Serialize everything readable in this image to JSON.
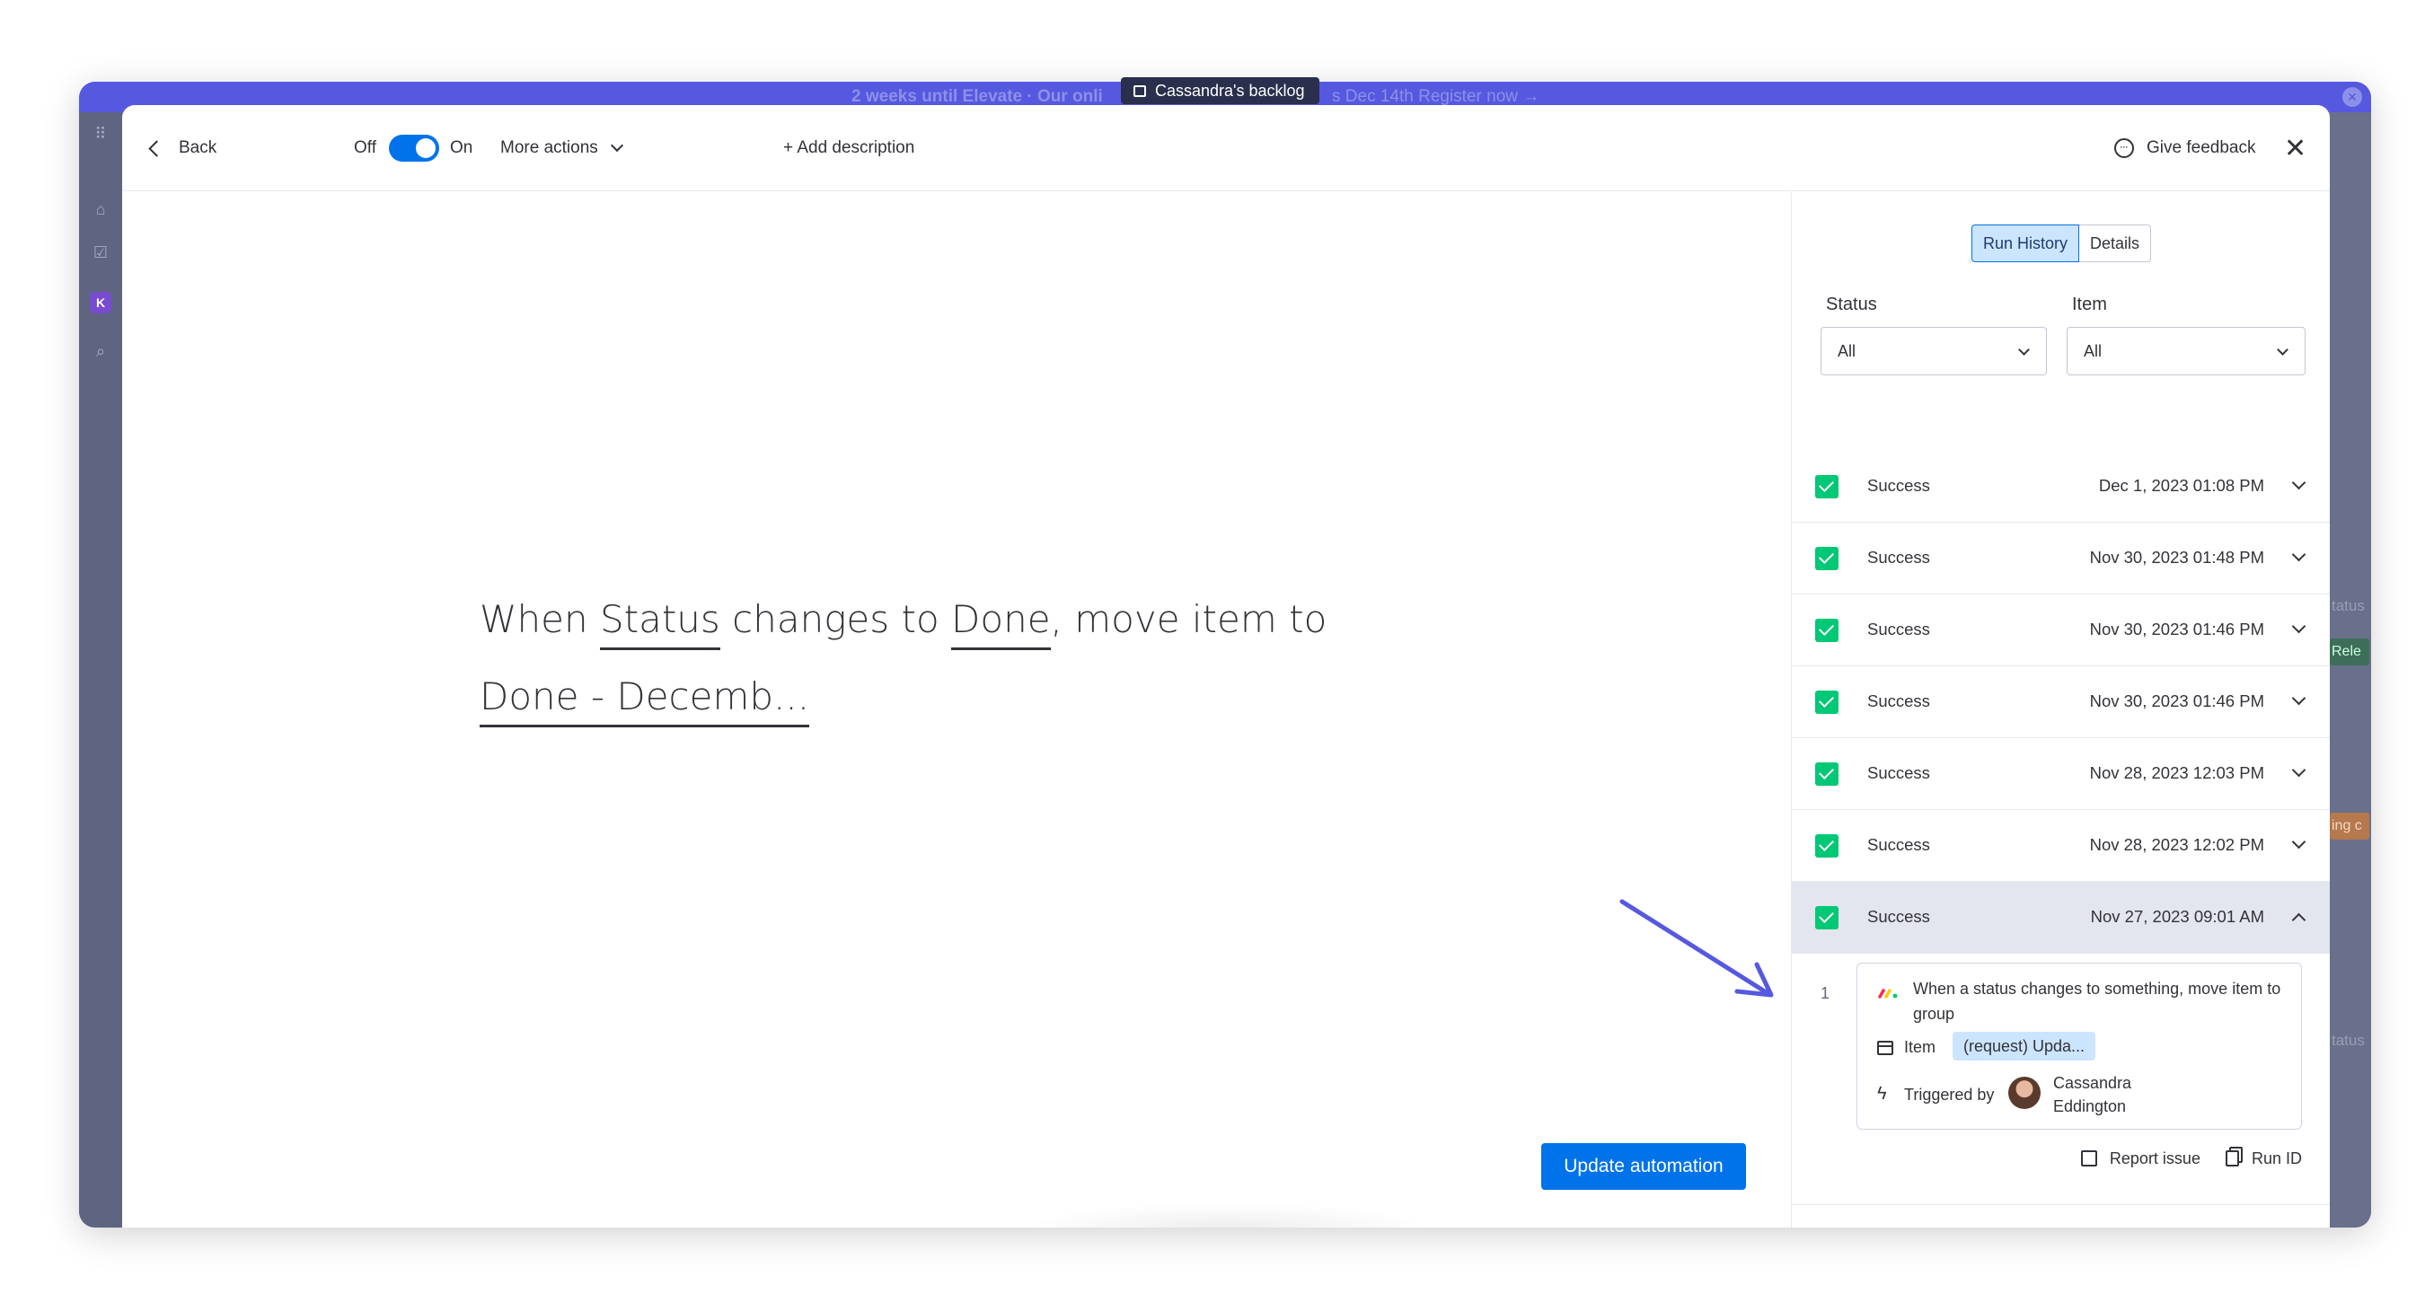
{
  "background": {
    "banner_text": "2 weeks until Elevate · Our onli",
    "banner_text2": "s Dec 14th   Register now →",
    "board_tooltip": "Cassandra's backlog",
    "right_strip": {
      "status_label": "tatus",
      "release_label": "Rele",
      "pending_label": "ing c",
      "status_label2": "tatus"
    }
  },
  "header": {
    "back_label": "Back",
    "toggle_off_label": "Off",
    "toggle_on_label": "On",
    "toggle_state": "on",
    "more_actions_label": "More actions",
    "add_description_label": "+ Add description",
    "give_feedback_label": "Give feedback",
    "close_symbol": "✕"
  },
  "editor": {
    "sentence": {
      "part1": "When ",
      "field1": "Status",
      "part2": " changes to ",
      "field2": "Done",
      "part3": ", move item to",
      "field3": "Done - Decemb..."
    },
    "update_button_label": "Update automation"
  },
  "panel": {
    "tabs": [
      {
        "label": "Run History",
        "active": true
      },
      {
        "label": "Details",
        "active": false
      }
    ],
    "filters": {
      "status": {
        "label": "Status",
        "value": "All"
      },
      "item": {
        "label": "Item",
        "value": "All"
      }
    },
    "runs": [
      {
        "status": "Success",
        "date": "Dec 1, 2023 01:08 PM"
      },
      {
        "status": "Success",
        "date": "Nov 30, 2023 01:48 PM"
      },
      {
        "status": "Success",
        "date": "Nov 30, 2023 01:46 PM"
      },
      {
        "status": "Success",
        "date": "Nov 30, 2023 01:46 PM"
      },
      {
        "status": "Success",
        "date": "Nov 28, 2023 12:03 PM"
      },
      {
        "status": "Success",
        "date": "Nov 28, 2023 12:02 PM"
      },
      {
        "status": "Success",
        "date": "Nov 27, 2023 09:01 AM"
      }
    ],
    "expanded_run": {
      "step_number": "1",
      "title": "When a status changes to something, move item to group",
      "item_label": "Item",
      "item_value": "(request) Upda...",
      "triggered_by_label": "Triggered by",
      "triggered_by_name": "Cassandra Eddington",
      "report_issue_label": "Report issue",
      "run_id_label": "Run ID"
    }
  },
  "colors": {
    "primary": "#0073ea",
    "success": "#00c875",
    "banner": "#5559df",
    "annotation_arrow": "#5559df"
  }
}
